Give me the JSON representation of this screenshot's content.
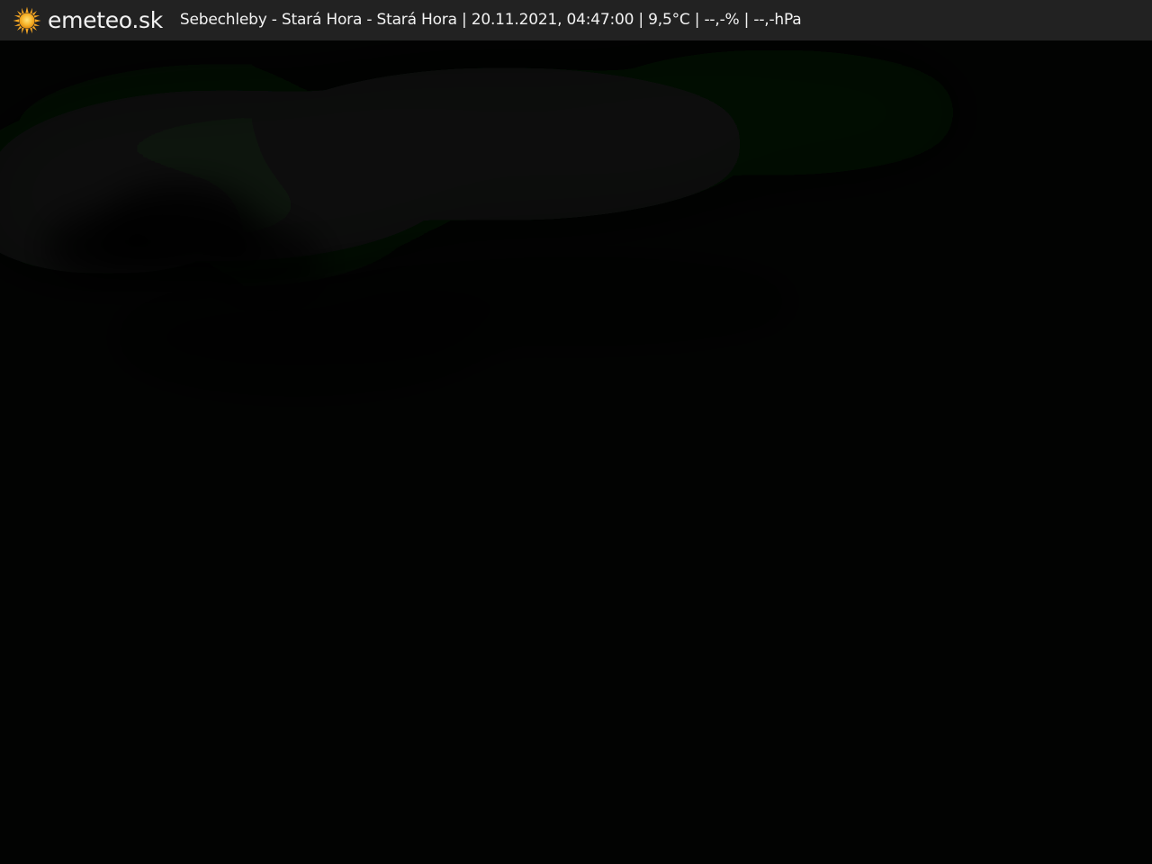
{
  "topbar": {
    "logo_icon": "sun-icon",
    "brand": "emeteo.sk",
    "location": "Sebechleby - Stará Hora - Stará Hora",
    "datetime": "20.11.2021, 04:47:00",
    "temperature": "9,5°C",
    "humidity": "--,-%",
    "pressure": "--,-hPa",
    "caption": "Sebechleby - Stará Hora - Stará Hora | 20.11.2021, 04:47:00 | 9,5°C | --,-% | --,-hPa"
  },
  "colors": {
    "bar_background": "#222222",
    "bar_text": "#f2f2f2",
    "sun": "#f5a623",
    "image_background": "#020302"
  }
}
